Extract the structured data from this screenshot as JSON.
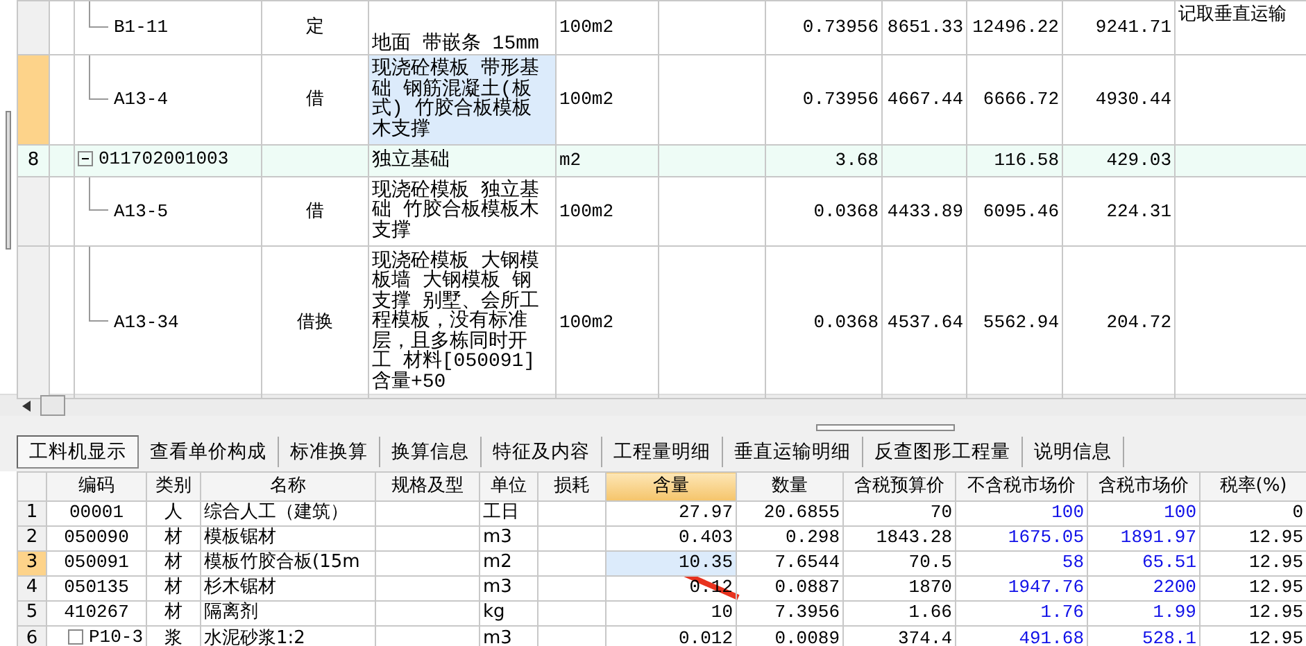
{
  "top_grid": {
    "rows": [
      {
        "number": "",
        "kind": "item",
        "code": "B1-11",
        "column_3": "定",
        "name": "地面 带嵌条 15mm",
        "unit": "100m2",
        "column_7": "0.73956",
        "column_8": "8651.33",
        "column_9": "12496.22",
        "column_10": "9241.71",
        "column_11": "记取垂直运输",
        "selected": false
      },
      {
        "number": "",
        "kind": "item",
        "code": "A13-4",
        "column_3": "借",
        "name": "现浇砼模板 带形基础 钢筋混凝土(板式) 竹胶合板模板木支撑",
        "unit": "100m2",
        "column_7": "0.73956",
        "column_8": "4667.44",
        "column_9": "6666.72",
        "column_10": "4930.44",
        "column_11": "",
        "selected": true
      },
      {
        "number": "8",
        "kind": "group",
        "expanded": true,
        "code": "011702001003",
        "column_3": "",
        "name": "独立基础",
        "unit": "m2",
        "column_7": "3.68",
        "column_8": "",
        "column_9": "116.58",
        "column_10": "429.03",
        "column_11": "",
        "selected": false
      },
      {
        "number": "",
        "kind": "item",
        "code": "A13-5",
        "column_3": "借",
        "name": "现浇砼模板 独立基础 竹胶合板模板木支撑",
        "unit": "100m2",
        "column_7": "0.0368",
        "column_8": "4433.89",
        "column_9": "6095.46",
        "column_10": "224.31",
        "column_11": "",
        "selected": false
      },
      {
        "number": "",
        "kind": "item",
        "code": "A13-34",
        "column_3": "借换",
        "name": "现浇砼模板 大钢模板墙 大钢模板 钢支撑  别墅、会所工程模板，没有标准层，且多栋同时开工 材料[050091] 含量+50",
        "unit": "100m2",
        "column_7": "0.0368",
        "column_8": "4537.64",
        "column_9": "5562.94",
        "column_10": "204.72",
        "column_11": "",
        "selected": false
      }
    ]
  },
  "tabs": [
    {
      "label": "工料机显示",
      "selected": true
    },
    {
      "label": "查看单价构成",
      "selected": false
    },
    {
      "label": "标准换算",
      "selected": false
    },
    {
      "label": "换算信息",
      "selected": false
    },
    {
      "label": "特征及内容",
      "selected": false
    },
    {
      "label": "工程量明细",
      "selected": false
    },
    {
      "label": "垂直运输明细",
      "selected": false
    },
    {
      "label": "反查图形工程量",
      "selected": false
    },
    {
      "label": "说明信息",
      "selected": false
    }
  ],
  "materials": {
    "columns": [
      {
        "label": "编码",
        "selected": false
      },
      {
        "label": "类别",
        "selected": false
      },
      {
        "label": "名称",
        "selected": false
      },
      {
        "label": "规格及型",
        "selected": false
      },
      {
        "label": "单位",
        "selected": false
      },
      {
        "label": "损耗",
        "selected": false
      },
      {
        "label": "含量",
        "selected": true
      },
      {
        "label": "数量",
        "selected": false
      },
      {
        "label": "含税预算价",
        "selected": false
      },
      {
        "label": "不含税市场价",
        "selected": false
      },
      {
        "label": "含税市场价",
        "selected": false
      },
      {
        "label": "税率(%)",
        "selected": false
      }
    ],
    "rows": [
      {
        "number": "1",
        "expandable": false,
        "cells": [
          "00001",
          "人",
          "综合人工（建筑）",
          "",
          "工日",
          "",
          "27.97",
          "20.6855",
          "70",
          "100",
          "100",
          "0"
        ],
        "selected": false
      },
      {
        "number": "2",
        "expandable": false,
        "cells": [
          "050090",
          "材",
          "模板锯材",
          "",
          "m3",
          "",
          "0.403",
          "0.298",
          "1843.28",
          "1675.05",
          "1891.97",
          "12.95"
        ],
        "selected": false
      },
      {
        "number": "3",
        "expandable": false,
        "cells": [
          "050091",
          "材",
          "模板竹胶合板(15m",
          "",
          "m2",
          "",
          "10.35",
          "7.6544",
          "70.5",
          "58",
          "65.51",
          "12.95"
        ],
        "selected": true
      },
      {
        "number": "4",
        "expandable": false,
        "cells": [
          "050135",
          "材",
          "杉木锯材",
          "",
          "m3",
          "",
          "0.12",
          "0.0887",
          "1870",
          "1947.76",
          "2200",
          "12.95"
        ],
        "selected": false
      },
      {
        "number": "5",
        "expandable": false,
        "cells": [
          "410267",
          "材",
          "隔离剂",
          "",
          "kg",
          "",
          "10",
          "7.3956",
          "1.66",
          "1.76",
          "1.99",
          "12.95"
        ],
        "selected": false
      },
      {
        "number": "6",
        "expandable": true,
        "cells": [
          "P10-3",
          "浆",
          "水泥砂浆1:2",
          "",
          "m3",
          "",
          "0.012",
          "0.0089",
          "374.4",
          "491.68",
          "528.1",
          "12.95"
        ],
        "selected": false
      }
    ]
  }
}
